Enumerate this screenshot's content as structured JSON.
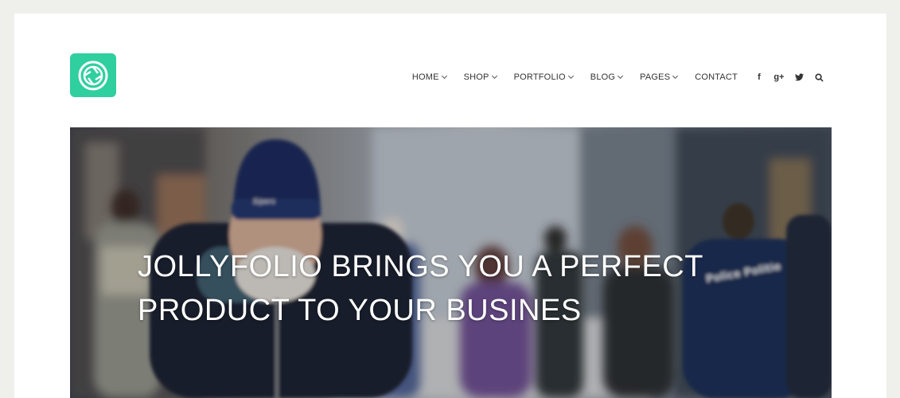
{
  "logo": {
    "icon": "camera-aperture-icon",
    "color": "#2fcf9f"
  },
  "nav": {
    "items": [
      {
        "label": "HOME",
        "has_dropdown": true
      },
      {
        "label": "SHOP",
        "has_dropdown": true
      },
      {
        "label": "PORTFOLIO",
        "has_dropdown": true
      },
      {
        "label": "BLOG",
        "has_dropdown": true
      },
      {
        "label": "PAGES",
        "has_dropdown": true
      },
      {
        "label": "CONTACT",
        "has_dropdown": false
      }
    ],
    "social": {
      "facebook": "f",
      "google_plus": "g+",
      "twitter": "twitter-icon",
      "search": "search-icon"
    }
  },
  "hero": {
    "title": "JOLLYFOLIO BRINGS YOU A PERFECT PRODUCT TO YOUR BUSINES"
  }
}
